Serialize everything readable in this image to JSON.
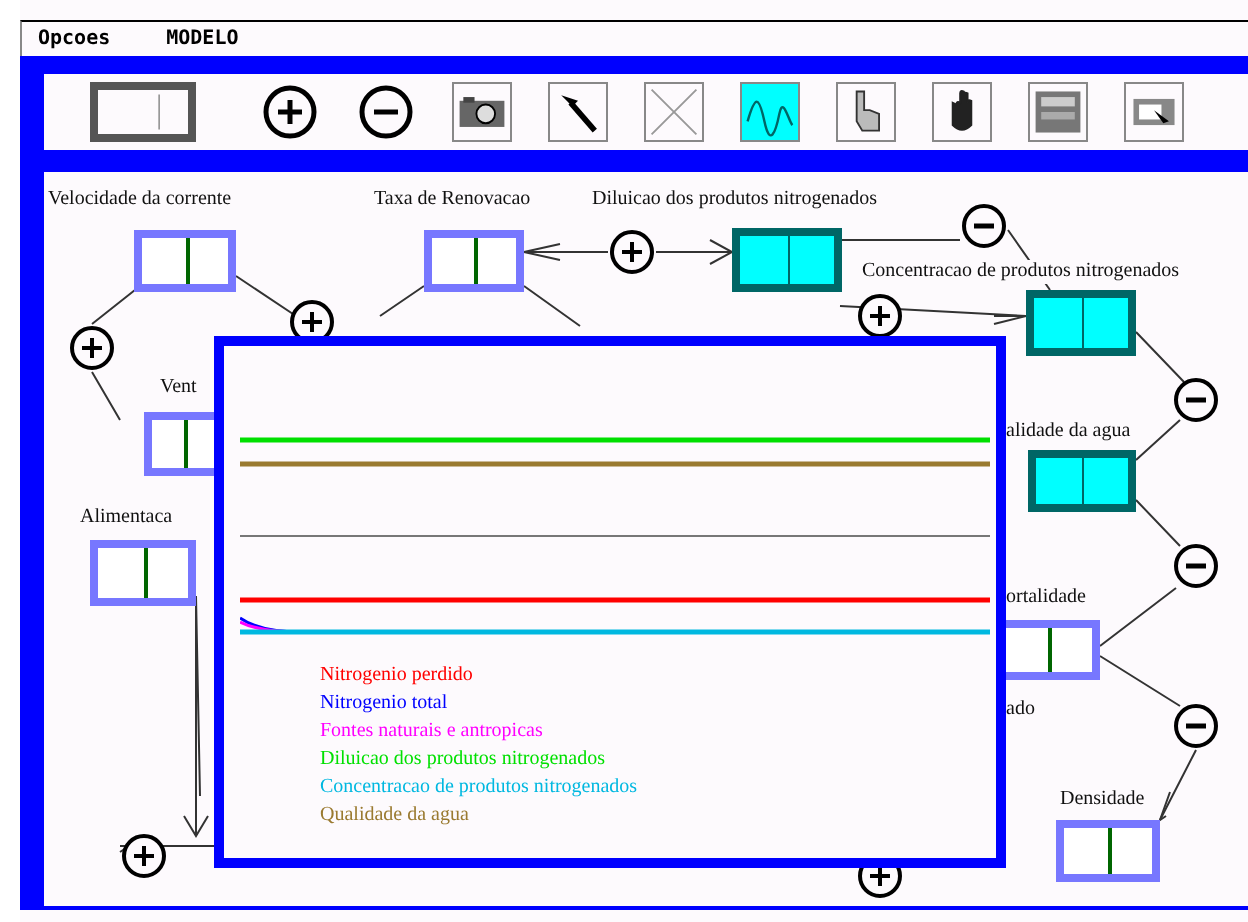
{
  "menu": [
    {
      "label": "Opcoes"
    },
    {
      "label": "MODELO"
    }
  ],
  "tools": [
    {
      "kind": "stock",
      "selected": false
    },
    {
      "kind": "plus",
      "selected": false
    },
    {
      "kind": "minus",
      "selected": false
    },
    {
      "kind": "camera",
      "selected": false
    },
    {
      "kind": "hammer",
      "selected": false
    },
    {
      "kind": "cross",
      "selected": false
    },
    {
      "kind": "wave",
      "selected": true
    },
    {
      "kind": "pointer",
      "selected": false
    },
    {
      "kind": "hand",
      "selected": false
    },
    {
      "kind": "panel",
      "selected": false
    },
    {
      "kind": "window",
      "selected": false
    }
  ],
  "nodes": [
    {
      "label": "Velocidade da corrente",
      "kind": "input"
    },
    {
      "label": "Taxa de Renovacao",
      "kind": "input"
    },
    {
      "label": "Diluicao dos produtos nitrogenados",
      "kind": "output"
    },
    {
      "label": "Concentracao de produtos nitrogenados",
      "kind": "output"
    },
    {
      "label": "alidade da agua",
      "kind": "output"
    },
    {
      "label": "Vent",
      "kind": "input"
    },
    {
      "label": "Alimentaca",
      "kind": "input"
    },
    {
      "label": "ortalidade",
      "kind": "input"
    },
    {
      "label": "ado",
      "kind": "label"
    },
    {
      "label": "Densidade",
      "kind": "input"
    }
  ],
  "signs": [
    {
      "kind": "plus"
    },
    {
      "kind": "minus"
    },
    {
      "kind": "plus"
    },
    {
      "kind": "plus"
    },
    {
      "kind": "plus"
    },
    {
      "kind": "minus"
    },
    {
      "kind": "minus"
    },
    {
      "kind": "minus"
    },
    {
      "kind": "plus"
    },
    {
      "kind": "plus"
    }
  ],
  "plot": {
    "legend": [
      {
        "label": "Nitrogenio perdido",
        "color": "#ff0000"
      },
      {
        "label": "Nitrogenio total",
        "color": "#0000ff"
      },
      {
        "label": "Fontes naturais e antropicas",
        "color": "#ff00ff"
      },
      {
        "label": "Diluicao dos produtos nitrogenados",
        "color": "#00e000"
      },
      {
        "label": "Concentracao de produtos nitrogenados",
        "color": "#00b8e0"
      },
      {
        "label": "Qualidade da agua",
        "color": "#9a7a30"
      }
    ]
  }
}
